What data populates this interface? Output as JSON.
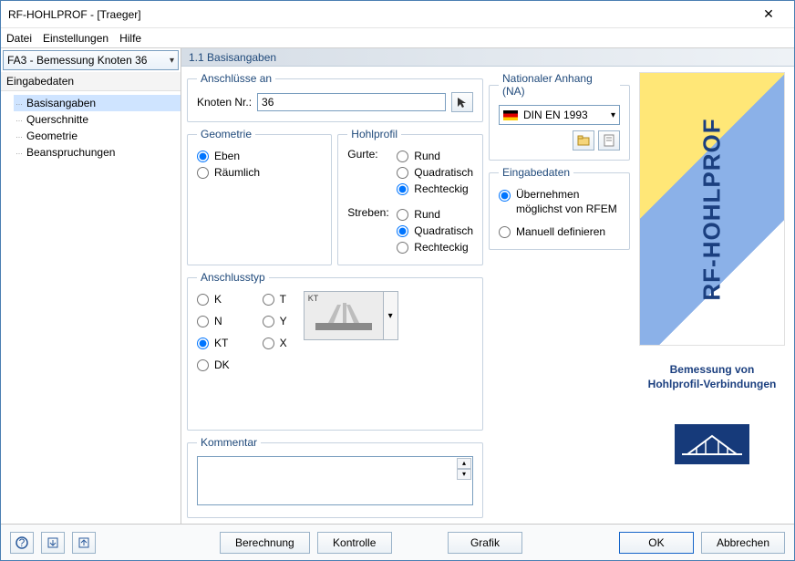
{
  "window": {
    "title": "RF-HOHLPROF - [Traeger]"
  },
  "menu": {
    "file": "Datei",
    "settings": "Einstellungen",
    "help": "Hilfe"
  },
  "sidebar": {
    "combo": "FA3 - Bemessung Knoten 36",
    "root": "Eingabedaten",
    "items": [
      "Basisangaben",
      "Querschnitte",
      "Geometrie",
      "Beanspruchungen"
    ],
    "selected": 0
  },
  "page": {
    "title": "1.1 Basisangaben"
  },
  "anschluesse": {
    "legend": "Anschlüsse an",
    "knoten_label": "Knoten Nr.:",
    "knoten_value": "36",
    "pick_icon": "pick-node-icon"
  },
  "geometrie": {
    "legend": "Geometrie",
    "options": [
      "Eben",
      "Räumlich"
    ],
    "selected": 0
  },
  "hohlprofil": {
    "legend": "Hohlprofil",
    "gurte_label": "Gurte:",
    "gurte_options": [
      "Rund",
      "Quadratisch",
      "Rechteckig"
    ],
    "gurte_selected": 2,
    "streben_label": "Streben:",
    "streben_options": [
      "Rund",
      "Quadratisch",
      "Rechteckig"
    ],
    "streben_selected": 1
  },
  "anschlusstyp": {
    "legend": "Anschlusstyp",
    "col1": [
      "K",
      "N",
      "KT",
      "DK"
    ],
    "col2": [
      "T",
      "Y",
      "X"
    ],
    "selected": "KT",
    "thumb_label": "KT"
  },
  "na": {
    "legend": "Nationaler Anhang (NA)",
    "value": "DIN EN 1993",
    "btn1_icon": "open-library-icon",
    "btn2_icon": "edit-na-icon"
  },
  "eingabedaten": {
    "legend": "Eingabedaten",
    "options": [
      "Übernehmen möglichst von RFEM",
      "Manuell definieren"
    ],
    "selected": 0
  },
  "kommentar": {
    "legend": "Kommentar",
    "value": ""
  },
  "brand": {
    "name": "RF-HOHLPROF",
    "subtitle1": "Bemessung von",
    "subtitle2": "Hohlprofil-Verbindungen"
  },
  "footer": {
    "help_icon": "help-icon",
    "import_icon": "import-icon",
    "export_icon": "export-icon",
    "berechnung": "Berechnung",
    "kontrolle": "Kontrolle",
    "grafik": "Grafik",
    "ok": "OK",
    "cancel": "Abbrechen"
  }
}
